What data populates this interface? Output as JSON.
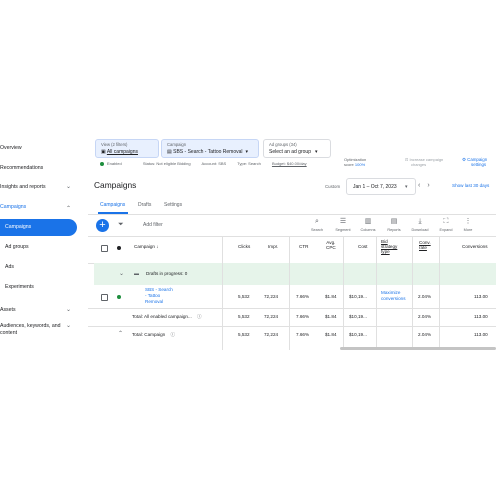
{
  "nav": {
    "items": [
      {
        "label": "Overview"
      },
      {
        "label": "Recommendations"
      },
      {
        "label": "Insights and reports"
      },
      {
        "label": "Campaigns"
      },
      {
        "label": "Campaigns"
      },
      {
        "label": "Ad groups"
      },
      {
        "label": "Ads"
      },
      {
        "label": "Experiments"
      },
      {
        "label": "Assets"
      },
      {
        "label": "Audiences, keywords, and"
      },
      {
        "label": "content"
      }
    ]
  },
  "filters": {
    "view": {
      "title": "View (2 filters)",
      "value": "All campaigns"
    },
    "campaign": {
      "title": "Campaign",
      "value": "SBS - Search - Tattoo Removal"
    },
    "adgroup": {
      "title": "Ad groups (34)",
      "value": "Select an ad group"
    }
  },
  "status": {
    "enabled": "Enabled",
    "status": "Status: Not eligible Bidding",
    "account": "Account: SBS",
    "type": "Type: Search",
    "budget": "Budget: $40.00/day"
  },
  "optimization": {
    "label1": "Optimization",
    "label2": "score",
    "value": "100%"
  },
  "increase": {
    "line1": "Increase campaign",
    "line2": "changes"
  },
  "campaign_settings": {
    "line1": "Campaign",
    "line2": "settings"
  },
  "page_title": "Campaigns",
  "date": {
    "label": "Custom",
    "range": "Jan 1 – Oct 7, 2023",
    "show_last": "Show last 30 days"
  },
  "tabs": [
    "Campaigns",
    "Drafts",
    "Settings"
  ],
  "toolbar": {
    "add_filter": "Add filter",
    "tools": [
      "Search",
      "Segment",
      "Columns",
      "Reports",
      "Download",
      "Expand",
      "More"
    ]
  },
  "table": {
    "headers": {
      "campaign": "Campaign ↓",
      "clicks": "Clicks",
      "impr": "Impr.",
      "ctr": "CTR",
      "avg_cpc_1": "Avg.",
      "avg_cpc_2": "CPC",
      "cost": "Cost",
      "bid_1": "Bid",
      "bid_2": "strategy",
      "bid_3": "type",
      "conv_rate_1": "Conv.",
      "conv_rate_2": "rate",
      "conversions": "Conversions"
    },
    "drafts_row": "Drafts in progress: 0",
    "row": {
      "name_1": "SBS - Search",
      "name_2": "- Tattoo",
      "name_3": "Removal",
      "clicks": "5,532",
      "impr": "72,224",
      "ctr": "7.66%",
      "avg_cpc": "$1.84",
      "cost": "$10,19...",
      "bid_1": "Maximize",
      "bid_2": "conversions",
      "conv_rate": "2.04%",
      "conversions": "113.00"
    },
    "total_enabled": {
      "label": "Total: All enabled campaign...",
      "clicks": "5,532",
      "impr": "72,224",
      "ctr": "7.66%",
      "avg_cpc": "$1.84",
      "cost": "$10,19...",
      "conv_rate": "2.04%",
      "conversions": "113.00"
    },
    "total_campaign": {
      "label": "Total: Campaign",
      "clicks": "5,532",
      "impr": "72,224",
      "ctr": "7.66%",
      "avg_cpc": "$1.84",
      "cost": "$10,19...",
      "conv_rate": "2.04%",
      "conversions": "113.00"
    }
  }
}
